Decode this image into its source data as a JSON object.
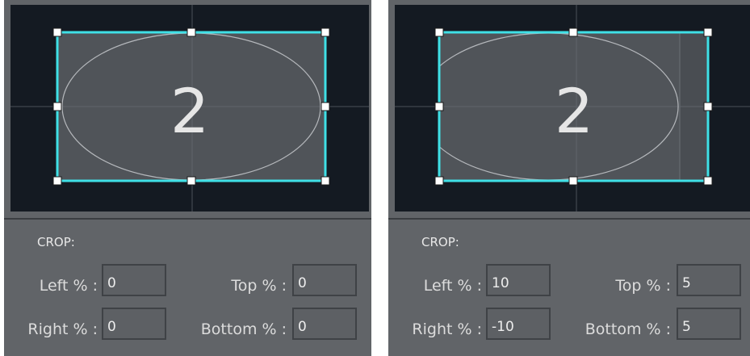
{
  "panels": [
    {
      "frame_number": "2",
      "section_title": "CROP:",
      "left_label": "Left % :",
      "left_value": "0",
      "top_label": "Top % :",
      "top_value": "0",
      "right_label": "Right % :",
      "right_value": "0",
      "bottom_label": "Bottom % :",
      "bottom_value": "0"
    },
    {
      "frame_number": "2",
      "section_title": "CROP:",
      "left_label": "Left % :",
      "left_value": "10",
      "top_label": "Top % :",
      "top_value": "5",
      "right_label": "Right % :",
      "right_value": "-10",
      "bottom_label": "Bottom % :",
      "bottom_value": "5"
    }
  ],
  "colors": {
    "panel_bg": "#616468",
    "preview_bg": "#141a22",
    "crop_frame": "#3fe0e6",
    "handle_fill": "#ffffff"
  }
}
